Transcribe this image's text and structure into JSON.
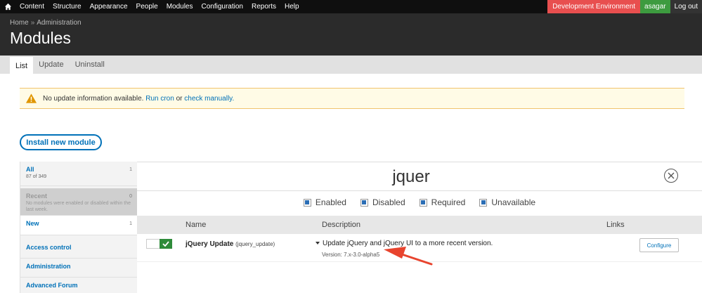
{
  "toolbar": {
    "menu": [
      "Content",
      "Structure",
      "Appearance",
      "People",
      "Modules",
      "Configuration",
      "Reports",
      "Help"
    ],
    "environment": "Development Environment",
    "user": "asagar",
    "logout": "Log out"
  },
  "header": {
    "breadcrumb_home": "Home",
    "breadcrumb_sep": "»",
    "breadcrumb_admin": "Administration",
    "title": "Modules"
  },
  "tabs": [
    "List",
    "Update",
    "Uninstall"
  ],
  "warning": {
    "text": "No update information available.",
    "run_cron": "Run cron",
    "or": "or",
    "check_manually": "check manually."
  },
  "install_button": "Install new module",
  "sidebar": {
    "items": [
      {
        "label": "All",
        "count": "1",
        "sub": "87 of 349"
      },
      {
        "label": "Recent",
        "count": "0",
        "sub": "No modules were enabled or disabled within the last week."
      },
      {
        "label": "New",
        "count": "1",
        "sub": ""
      },
      {
        "label": "Access control",
        "count": "",
        "sub": ""
      },
      {
        "label": "Administration",
        "count": "",
        "sub": ""
      },
      {
        "label": "Advanced Forum",
        "count": "",
        "sub": ""
      }
    ]
  },
  "search": {
    "value": "jquer"
  },
  "filters": [
    "Enabled",
    "Disabled",
    "Required",
    "Unavailable"
  ],
  "table": {
    "headers": {
      "name": "Name",
      "description": "Description",
      "links": "Links"
    },
    "row": {
      "name": "jQuery Update",
      "machine_name": "(jquery_update)",
      "description": "Update jQuery and jQuery UI to a more recent version.",
      "version": "Version: 7.x-3.0-alpha5",
      "configure": "Configure"
    }
  },
  "colors": {
    "toolbar": "#0f0f0f",
    "header": "#2b2b2b",
    "link": "#0071b8",
    "env": "#e84f4f",
    "user": "#3d9b3f",
    "toggle_on": "#2e8b3a",
    "arrow": "#e8442e"
  }
}
